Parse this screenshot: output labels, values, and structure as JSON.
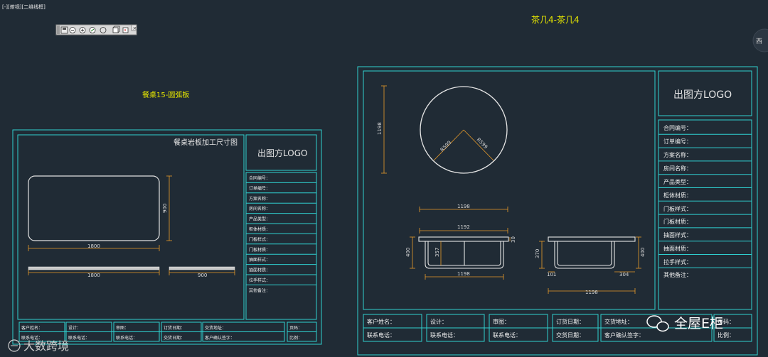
{
  "viewport": {
    "label": "[-][俯视][二维线框]"
  },
  "toolbar": {
    "icons": [
      "save-icon",
      "zoom-icon",
      "pan-icon",
      "orbit-icon",
      "view-icon",
      "cube-icon",
      "box-icon"
    ],
    "close_label": "×"
  },
  "compass": {
    "label": "西"
  },
  "left_sheet": {
    "title": "餐桌15-圆弧板",
    "drawing_title": "餐桌岩板加工尺寸图",
    "logo": "出图方LOGO",
    "fields": [
      "合同编号：",
      "订单编号：",
      "方案名称：",
      "房间名称：",
      "产品类型：",
      "柜体材质：",
      "门板样式：",
      "门板材质：",
      "抽面样式：",
      "抽面材质：",
      "拉手样式：",
      "其他备注："
    ],
    "footer": {
      "row1": [
        "客户姓名：",
        "设计：",
        "审图：",
        "订货日期：",
        "交货地址：",
        "页码："
      ],
      "row2": [
        "联系电话：",
        "联系电话：",
        "联系电话：",
        "交货日期：",
        "客户确认签字：",
        "比例："
      ]
    },
    "dims": {
      "width": "1800",
      "height": "900",
      "strip_long": "1800",
      "strip_short": "900"
    }
  },
  "right_sheet": {
    "title": "茶几4-茶几4",
    "logo": "出图方LOGO",
    "fields": [
      "合同编号：",
      "订单编号：",
      "方案名称：",
      "房间名称：",
      "产品类型：",
      "柜体材质：",
      "门板样式：",
      "门板材质：",
      "抽面样式：",
      "抽面材质：",
      "拉手样式：",
      "其他备注："
    ],
    "footer": {
      "row1": [
        "客户姓名：",
        "设计：",
        "审图：",
        "订货日期：",
        "交货地址：",
        "页码："
      ],
      "row2": [
        "联系电话：",
        "联系电话：",
        "联系电话：",
        "交货日期：",
        "客户确认签字：",
        "比例："
      ]
    },
    "dims": {
      "circle_dia": "1198",
      "radius_a": "R599",
      "radius_b": "R599",
      "top_width": "1198",
      "front_inner": "1192",
      "front_height": "400",
      "front_sub": "357",
      "front_thk": "30",
      "front_bottom": "1198",
      "side_height": "370",
      "side_right": "400",
      "side_left_off": "101",
      "side_right_off": "304",
      "side_bottom": "1198"
    }
  },
  "watermarks": {
    "left": "大数跨境",
    "right": "全屋E柜"
  }
}
